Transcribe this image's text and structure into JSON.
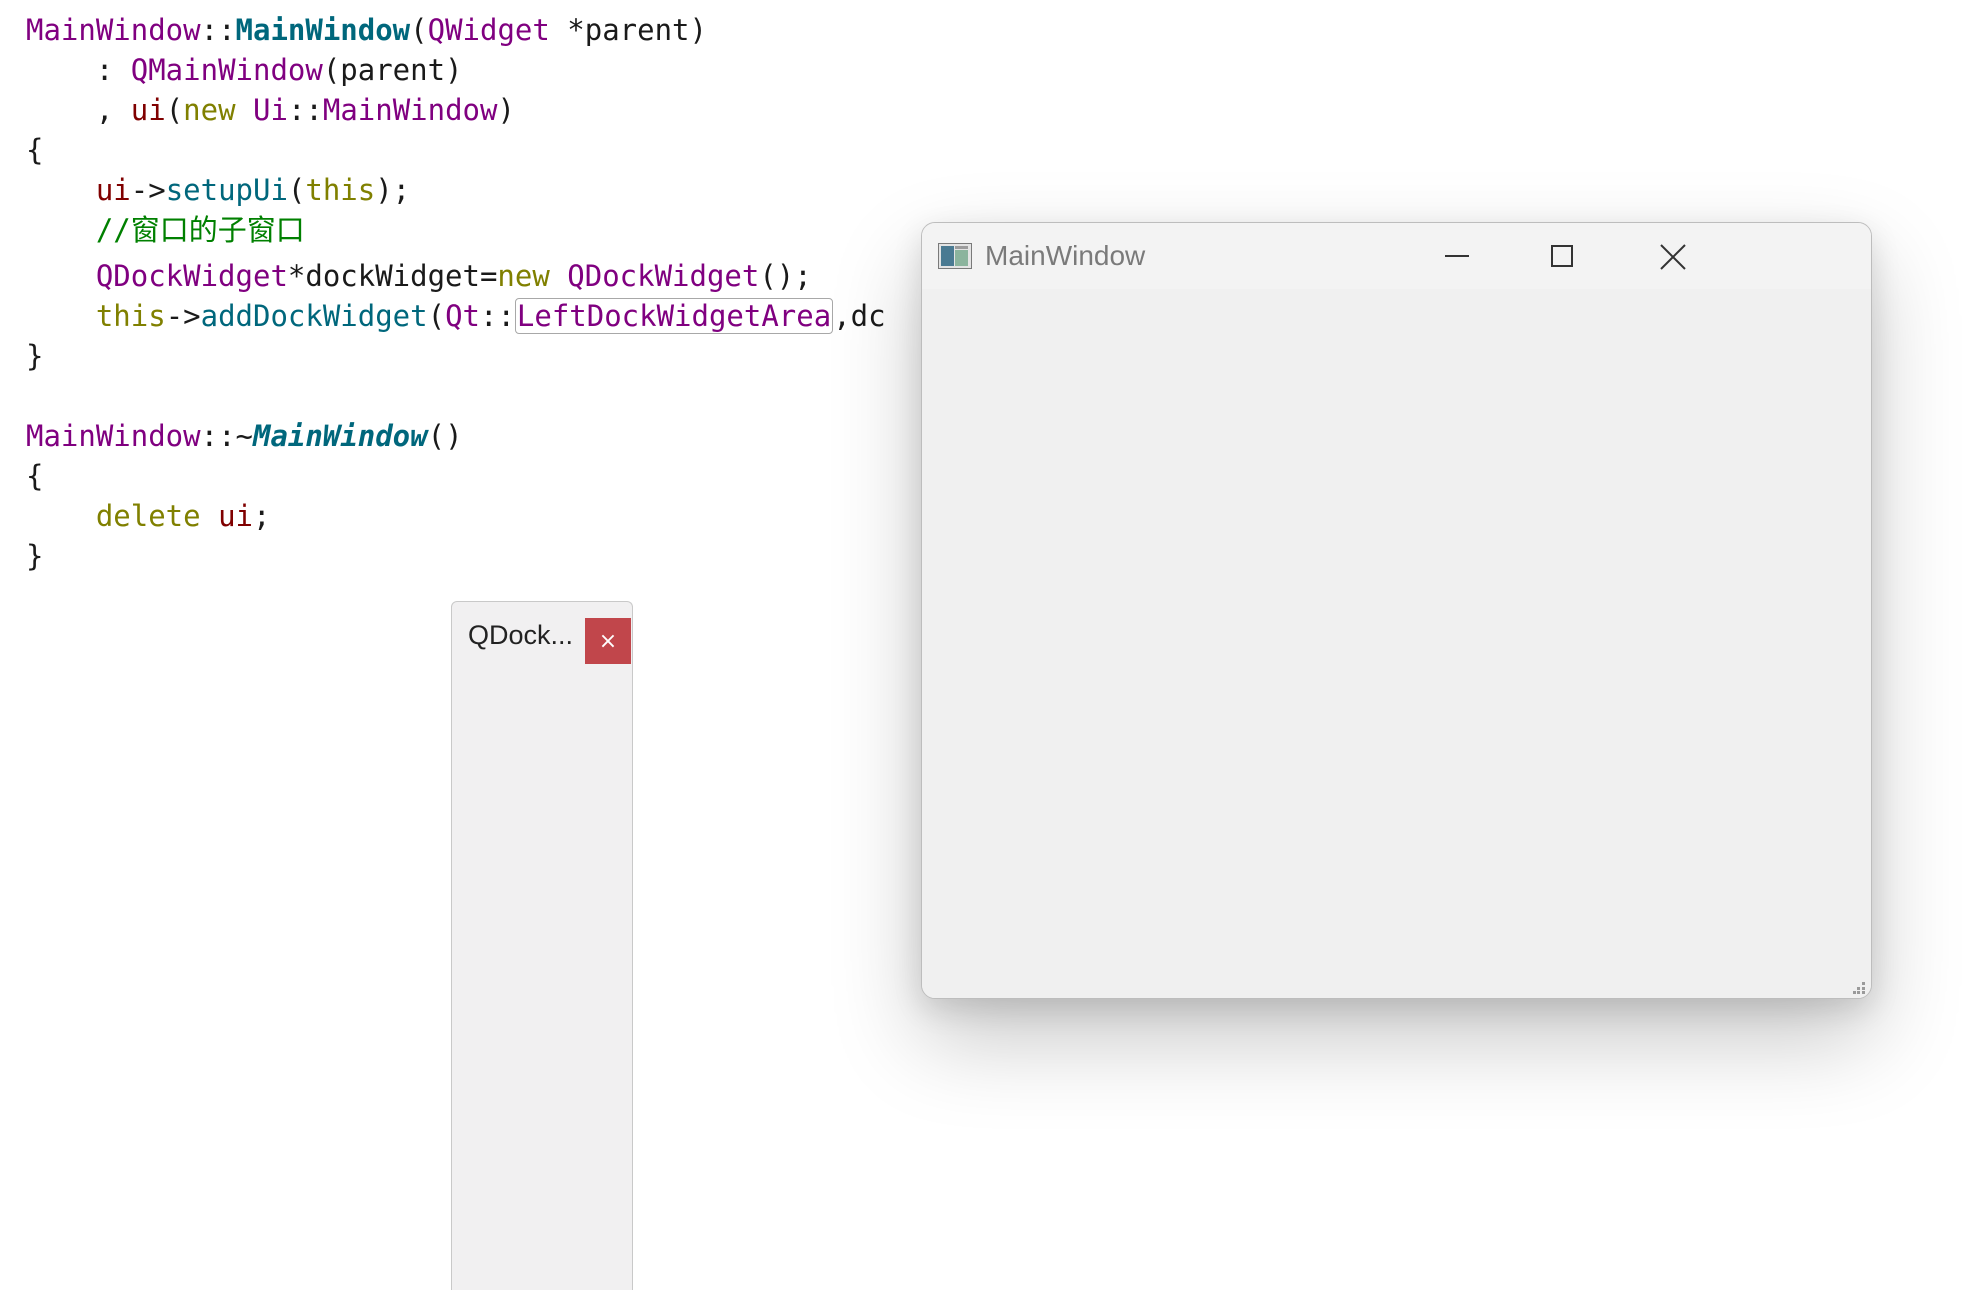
{
  "code": {
    "line1": {
      "cls": "MainWindow",
      "sep": "::",
      "fn": "MainWindow",
      "open": "(",
      "type": "QWidget",
      "rest": " *parent)"
    },
    "line2": {
      "prefix": "    : ",
      "fn": "QMainWindow",
      "args": "(parent)"
    },
    "line3": {
      "prefix": "    , ",
      "member": "ui",
      "open": "(",
      "kw": "new",
      "sp": " ",
      "ns": "Ui",
      "sep": "::",
      "type": "MainWindow",
      "close": ")"
    },
    "line4": "{",
    "line5": {
      "indent": "    ",
      "member": "ui",
      "arrow": "->",
      "fn": "setupUi",
      "open": "(",
      "kw": "this",
      "close": ");"
    },
    "line6": "    //窗口的子窗口",
    "line7": {
      "indent": "    ",
      "type": "QDockWidget",
      "mid": "*dockWidget=",
      "kw": "new",
      "sp": " ",
      "type2": "QDockWidget",
      "close": "();"
    },
    "line8": {
      "indent": "    ",
      "kw": "this",
      "arrow": "->",
      "fn": "addDockWidget",
      "open": "(",
      "ns": "Qt",
      "sep": "::",
      "enum": "LeftDockWidgetArea",
      "rest": ",dc"
    },
    "line9": "}",
    "line10": {
      "cls": "MainWindow",
      "sep": "::~",
      "fn": "MainWindow",
      "close": "()"
    },
    "line11": "{",
    "line12": {
      "indent": "    ",
      "kw": "delete",
      "sp": " ",
      "member": "ui",
      "close": ";"
    },
    "line13": "}"
  },
  "dock": {
    "title": "QDock...",
    "close_glyph": "×",
    "close_color": "#c1464b"
  },
  "mainwindow": {
    "title": "MainWindow",
    "icon": "application-window-icon",
    "minimize_icon": "minimize-icon",
    "maximize_icon": "maximize-icon",
    "close_icon": "close-icon"
  }
}
